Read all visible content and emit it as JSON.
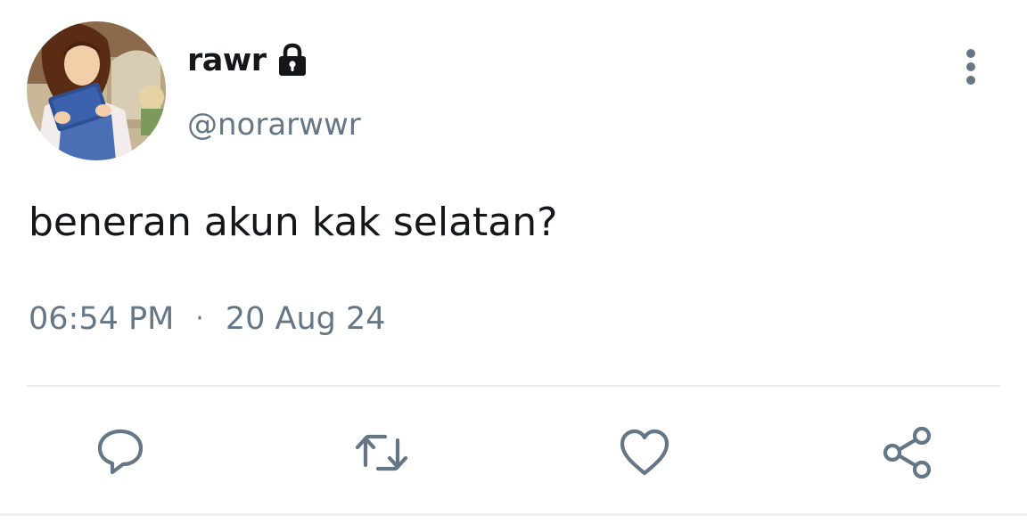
{
  "tweet": {
    "author": {
      "display_name": "rawr",
      "handle": "@norarwwr",
      "avatar_icon": "avatar-illustration",
      "protected_icon": "lock-icon"
    },
    "text": "beneran akun kak selatan?",
    "time": "06:54 PM",
    "separator": "·",
    "date": "20 Aug 24"
  },
  "actions": {
    "reply_icon": "reply-icon",
    "retweet_icon": "retweet-icon",
    "like_icon": "like-icon",
    "share_icon": "share-icon"
  },
  "menu_icon": "more-options-icon",
  "colors": {
    "text_primary": "#14171a",
    "text_secondary": "#657786",
    "divider": "#e6ecf0"
  }
}
